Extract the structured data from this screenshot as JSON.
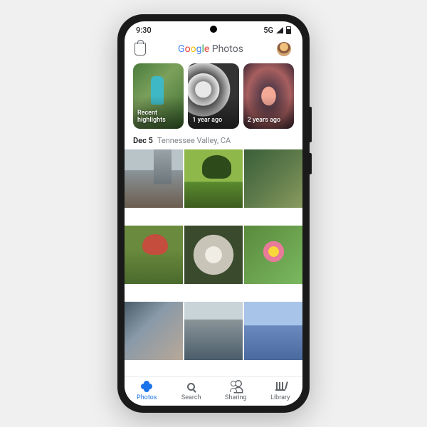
{
  "status": {
    "time": "9:30",
    "network": "5G"
  },
  "app": {
    "title_main": "Google",
    "title_sub": " Photos"
  },
  "highlights": [
    {
      "label": "Recent highlights"
    },
    {
      "label": "1 year ago"
    },
    {
      "label": "2 years ago"
    }
  ],
  "section": {
    "date": "Dec 5",
    "location": "Tennessee Valley, CA"
  },
  "nav": {
    "photos": "Photos",
    "search": "Search",
    "sharing": "Sharing",
    "library": "Library"
  }
}
